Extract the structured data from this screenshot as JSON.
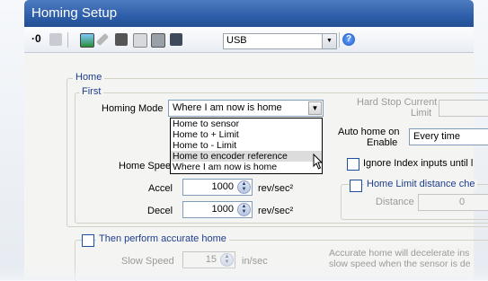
{
  "window": {
    "title": "Homing Setup"
  },
  "toolbar": {
    "icons": [
      "axis-icon",
      "undo-icon",
      "monitor-icon",
      "wrench-icon",
      "chip-icon",
      "copy-icon",
      "printer-icon",
      "book-icon"
    ],
    "port": "USB",
    "help": "?"
  },
  "home_group": {
    "legend": "Home",
    "first_legend": "First",
    "homing_mode_label": "Homing Mode",
    "homing_mode_value": "Where I am now is home",
    "homing_mode_options": [
      "Home to sensor",
      "Home to + Limit",
      "Home to - Limit",
      "Home to encoder reference",
      "Where I am now is home"
    ],
    "highlighted_option": "Home to encoder reference",
    "home_speed_label": "Home Speed",
    "accel_label": "Accel",
    "accel_value": "1000",
    "accel_unit": "rev/sec²",
    "decel_label": "Decel",
    "decel_value": "1000",
    "decel_unit": "rev/sec²",
    "hard_stop_label": "Hard Stop Current",
    "hard_stop_label2": "Limit",
    "auto_home_label": "Auto home on",
    "auto_home_label2": "Enable",
    "auto_home_value": "Every time",
    "ignore_index_label": "Ignore Index inputs until l",
    "home_limit_label": "Home Limit distance che",
    "distance_label": "Distance",
    "distance_value": "0"
  },
  "accurate_group": {
    "checkbox_label": "Then perform accurate home",
    "slow_speed_label": "Slow Speed",
    "slow_speed_value": "15",
    "slow_speed_unit": "in/sec",
    "note_line1": "Accurate home will decelerate ins",
    "note_line2": "slow speed when the sensor is de"
  },
  "colors": {
    "title_bar": "#2d5ea9",
    "legend_text": "#1d3d8f",
    "dropdown_highlight": "#dcdcdc"
  }
}
